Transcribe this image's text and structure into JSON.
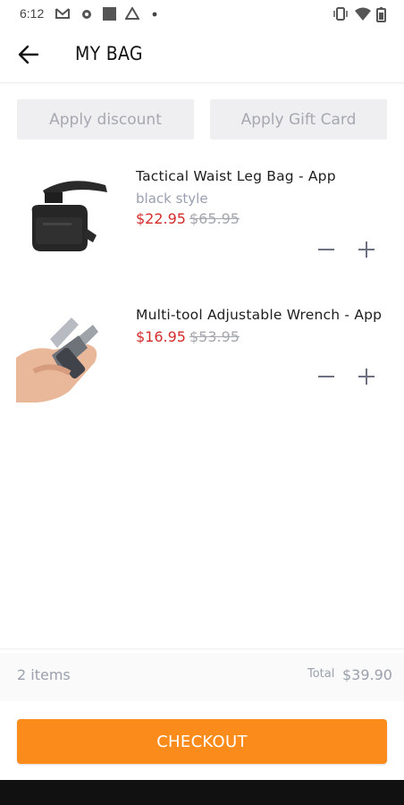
{
  "status_bar": {
    "time": "6:12",
    "icons": [
      "gmail-icon",
      "app-icon",
      "square-icon",
      "drive-icon",
      "dot-icon",
      "vibrate-icon",
      "wifi-icon",
      "battery-icon"
    ]
  },
  "header": {
    "title": "MY BAG"
  },
  "actions": {
    "apply_discount": "Apply discount",
    "apply_gift_card": "Apply Gift Card"
  },
  "cart_items": [
    {
      "name": "Tactical Waist Leg Bag - App",
      "variant": "black style",
      "sale_price": "$22.95",
      "original_price": "$65.95"
    },
    {
      "name": "Multi-tool Adjustable Wrench - App",
      "variant": "",
      "sale_price": "$16.95",
      "original_price": "$53.95"
    }
  ],
  "summary": {
    "items_count": "2 items",
    "total_label": "Total",
    "total_value": "$39.90"
  },
  "checkout_label": "CHECKOUT",
  "colors": {
    "accent": "#fb8b1a",
    "sale": "#d42b2b",
    "muted": "#9aa0ac"
  }
}
